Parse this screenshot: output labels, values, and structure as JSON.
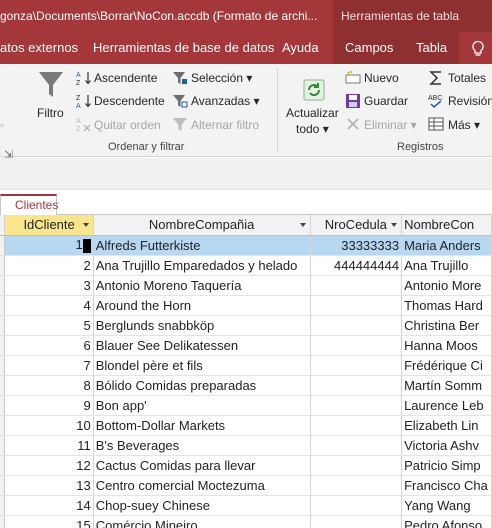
{
  "title_bar": {
    "title": "gonza\\Documents\\Borrar\\NoCon.accdb (Formato de archi...",
    "context_tab": "Herramientas de tabla"
  },
  "menu": {
    "items": [
      "atos externos",
      "Herramientas de base de datos",
      "Ayuda",
      "Campos",
      "Tabla"
    ]
  },
  "ribbon": {
    "filter_button": "Filtro",
    "ascending": "Ascendente",
    "descending": "Descendente",
    "remove_sort": "Quitar orden",
    "selection": "Selección",
    "advanced": "Avanzadas",
    "toggle_filter": "Alternar filtro",
    "sort_filter_group": "Ordenar y filtrar",
    "refresh_line1": "Actualizar",
    "refresh_line2": "todo",
    "new": "Nuevo",
    "save": "Guardar",
    "delete": "Eliminar",
    "totals": "Totales",
    "spelling": "Revisión",
    "more": "Más",
    "records_group": "Registros",
    "colors": {
      "accent": "#a4373a",
      "context": "#8e2f32"
    }
  },
  "document_tab": {
    "label": "Clientes"
  },
  "table": {
    "columns": [
      "IdCliente",
      "NombreCompañia",
      "NroCedula",
      "NombreCon"
    ],
    "rows": [
      {
        "id": "1",
        "company": "Alfreds Futterkiste",
        "cedula": "33333333",
        "contact": "Maria Anders"
      },
      {
        "id": "2",
        "company": "Ana Trujillo Emparedados y helado",
        "cedula": "444444444",
        "contact": "Ana Trujillo"
      },
      {
        "id": "3",
        "company": "Antonio Moreno Taquería",
        "cedula": "",
        "contact": "Antonio More"
      },
      {
        "id": "4",
        "company": "Around the Horn",
        "cedula": "",
        "contact": "Thomas Hard"
      },
      {
        "id": "5",
        "company": "Berglunds snabbköp",
        "cedula": "",
        "contact": "Christina Ber"
      },
      {
        "id": "6",
        "company": "Blauer See Delikatessen",
        "cedula": "",
        "contact": "Hanna Moos"
      },
      {
        "id": "7",
        "company": "Blondel père et fils",
        "cedula": "",
        "contact": "Frédérique Ci"
      },
      {
        "id": "8",
        "company": "Bólido Comidas preparadas",
        "cedula": "",
        "contact": "Martín Somm"
      },
      {
        "id": "9",
        "company": "Bon app'",
        "cedula": "",
        "contact": "Laurence Leb"
      },
      {
        "id": "10",
        "company": "Bottom-Dollar Markets",
        "cedula": "",
        "contact": "Elizabeth Lin"
      },
      {
        "id": "11",
        "company": "B's Beverages",
        "cedula": "",
        "contact": "Victoria Ashv"
      },
      {
        "id": "12",
        "company": "Cactus Comidas para llevar",
        "cedula": "",
        "contact": "Patricio Simp"
      },
      {
        "id": "13",
        "company": "Centro comercial Moctezuma",
        "cedula": "",
        "contact": "Francisco Cha"
      },
      {
        "id": "14",
        "company": "Chop-suey Chinese",
        "cedula": "",
        "contact": "Yang Wang"
      },
      {
        "id": "15",
        "company": "Comércio Mineiro",
        "cedula": "",
        "contact": "Pedro Afonso"
      }
    ]
  }
}
